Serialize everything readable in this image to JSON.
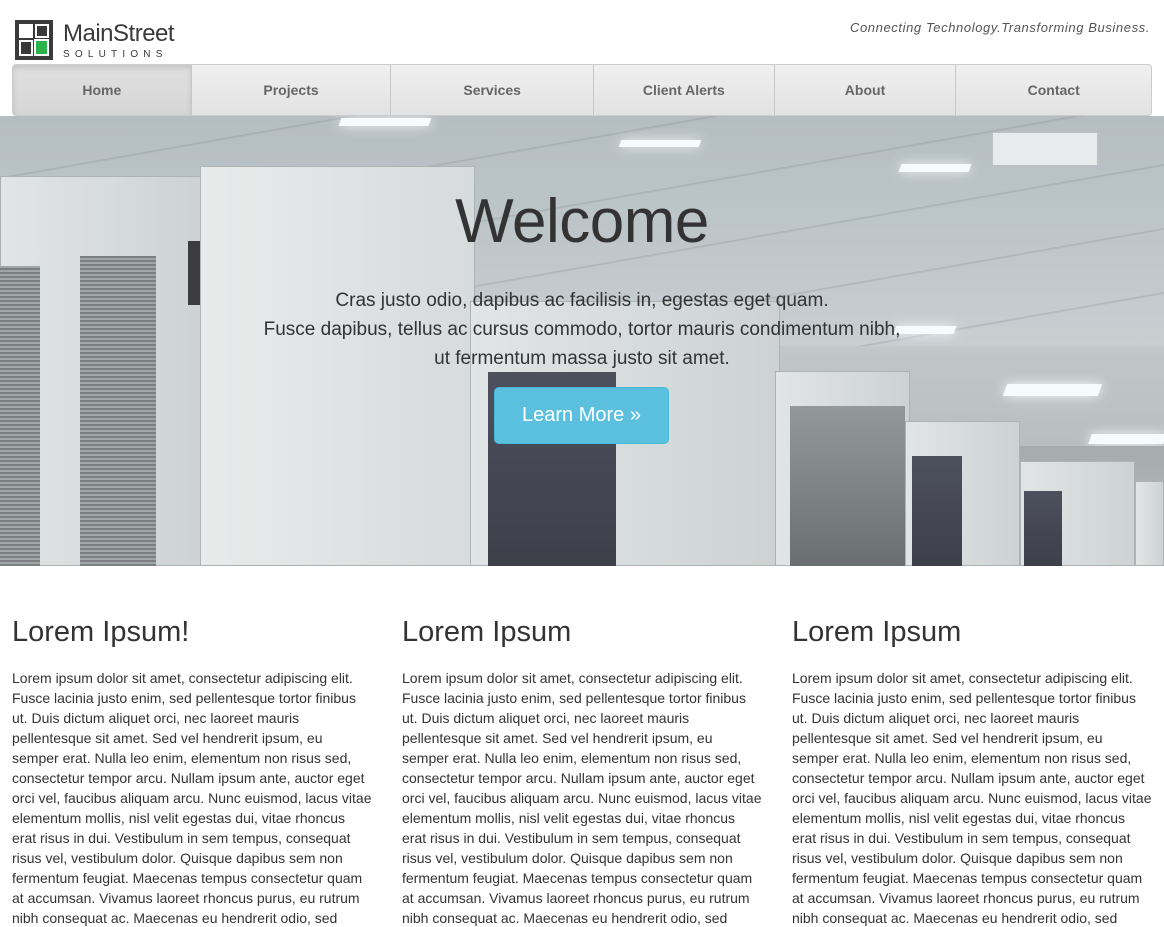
{
  "brand": {
    "name": "MainStreet",
    "sub": "SOLUTIONS",
    "tagline": "Connecting Technology.Transforming Business.",
    "colors": {
      "accent_green": "#2bb24c",
      "logo_dark": "#3a3a3a"
    }
  },
  "nav": {
    "items": [
      {
        "label": "Home",
        "active": true
      },
      {
        "label": "Projects",
        "active": false
      },
      {
        "label": "Services",
        "active": false
      },
      {
        "label": "Client Alerts",
        "active": false
      },
      {
        "label": "About",
        "active": false
      },
      {
        "label": "Contact",
        "active": false
      }
    ]
  },
  "hero": {
    "title": "Welcome",
    "lines": [
      "Cras justo odio, dapibus ac facilisis in, egestas eget quam.",
      "Fusce dapibus, tellus ac cursus commodo, tortor mauris condimentum nibh,",
      "ut fermentum massa justo sit amet."
    ],
    "button_label": "Learn More »",
    "button_color": "#5bc0de"
  },
  "columns": [
    {
      "heading": "Lorem Ipsum!",
      "body": "Lorem ipsum dolor sit amet, consectetur adipiscing elit. Fusce lacinia justo enim, sed pellentesque tortor finibus ut. Duis dictum aliquet orci, nec laoreet mauris pellentesque sit amet. Sed vel hendrerit ipsum, eu semper erat. Nulla leo enim, elementum non risus sed, consectetur tempor arcu. Nullam ipsum ante, auctor eget orci vel, faucibus aliquam arcu. Nunc euismod, lacus vitae elementum mollis, nisl velit egestas dui, vitae rhoncus erat risus in dui. Vestibulum in sem tempus, consequat risus vel, vestibulum dolor. Quisque dapibus sem non fermentum feugiat. Maecenas tempus consectetur quam at accumsan. Vivamus laoreet rhoncus purus, eu rutrum nibh consequat ac. Maecenas eu hendrerit odio, sed semper odio. Proin nisi velit"
    },
    {
      "heading": "Lorem Ipsum",
      "body": "Lorem ipsum dolor sit amet, consectetur adipiscing elit. Fusce lacinia justo enim, sed pellentesque tortor finibus ut. Duis dictum aliquet orci, nec laoreet mauris pellentesque sit amet. Sed vel hendrerit ipsum, eu semper erat. Nulla leo enim, elementum non risus sed, consectetur tempor arcu. Nullam ipsum ante, auctor eget orci vel, faucibus aliquam arcu. Nunc euismod, lacus vitae elementum mollis, nisl velit egestas dui, vitae rhoncus erat risus in dui. Vestibulum in sem tempus, consequat risus vel, vestibulum dolor. Quisque dapibus sem non fermentum feugiat. Maecenas tempus consectetur quam at accumsan. Vivamus laoreet rhoncus purus, eu rutrum nibh consequat ac. Maecenas eu hendrerit odio, sed semper odio. Proin nisi velit"
    },
    {
      "heading": "Lorem Ipsum",
      "body": "Lorem ipsum dolor sit amet, consectetur adipiscing elit. Fusce lacinia justo enim, sed pellentesque tortor finibus ut. Duis dictum aliquet orci, nec laoreet mauris pellentesque sit amet. Sed vel hendrerit ipsum, eu semper erat. Nulla leo enim, elementum non risus sed, consectetur tempor arcu. Nullam ipsum ante, auctor eget orci vel, faucibus aliquam arcu. Nunc euismod, lacus vitae elementum mollis, nisl velit egestas dui, vitae rhoncus erat risus in dui. Vestibulum in sem tempus, consequat risus vel, vestibulum dolor. Quisque dapibus sem non fermentum feugiat. Maecenas tempus consectetur quam at accumsan. Vivamus laoreet rhoncus purus, eu rutrum nibh consequat ac. Maecenas eu hendrerit odio, sed semper odio. Proin nisi velit"
    }
  ]
}
